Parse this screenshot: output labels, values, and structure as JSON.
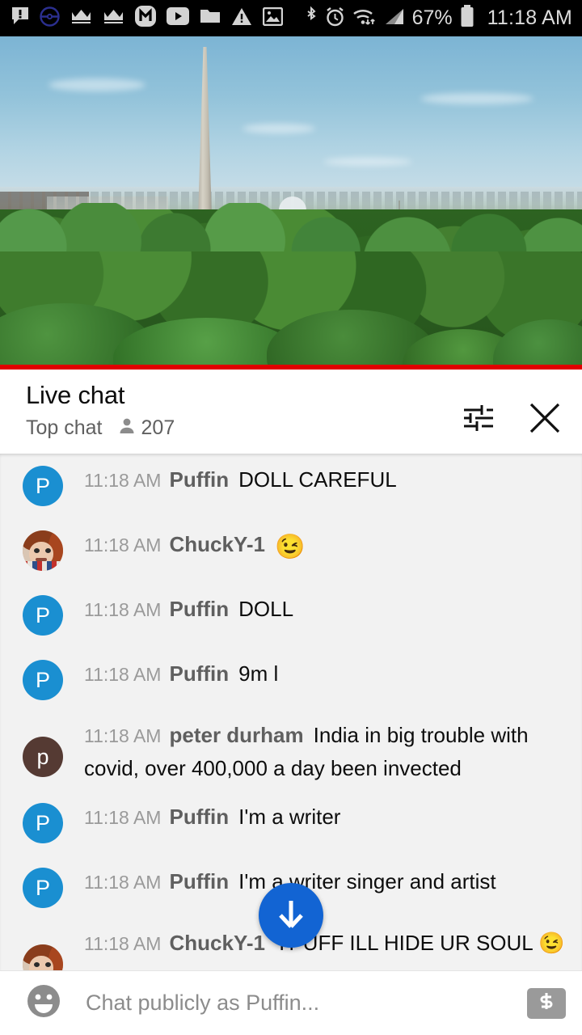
{
  "status_bar": {
    "time": "11:18 AM",
    "battery_percent": "67%",
    "left_icons": [
      "speech-bubble-alert-icon",
      "pokeball-icon",
      "crown-icon",
      "crown-icon",
      "m-app-icon",
      "youtube-icon",
      "folder-icon",
      "warning-triangle-icon",
      "image-icon"
    ],
    "right_icons": [
      "bluetooth-icon",
      "alarm-clock-icon",
      "wifi-icon",
      "cellular-signal-icon",
      "battery-icon"
    ]
  },
  "video": {
    "scene_description": "White House and Washington Monument live view",
    "progress_color": "#e00000"
  },
  "chat_header": {
    "title": "Live chat",
    "mode": "Top chat",
    "viewer_count": "207",
    "viewer_icon": "person-icon",
    "settings_icon": "tune-sliders-icon",
    "close_icon": "close-x-icon"
  },
  "messages": [
    {
      "time": "11:18 AM",
      "author": "Puffin",
      "text": "DOLL CAREFUL",
      "avatar_type": "letter",
      "avatar_letter": "P",
      "avatar_color": "#1a8fd1"
    },
    {
      "time": "11:18 AM",
      "author": "ChuckY-1",
      "text": "😉",
      "avatar_type": "photo",
      "avatar_letter": "",
      "avatar_color": "#c2866a"
    },
    {
      "time": "11:18 AM",
      "author": "Puffin",
      "text": "DOLL",
      "avatar_type": "letter",
      "avatar_letter": "P",
      "avatar_color": "#1a8fd1"
    },
    {
      "time": "11:18 AM",
      "author": "Puffin",
      "text": "9m l",
      "avatar_type": "letter",
      "avatar_letter": "P",
      "avatar_color": "#1a8fd1"
    },
    {
      "time": "11:18 AM",
      "author": "peter durham",
      "text": "India in big trouble with covid, over 400,000 a day been invected",
      "avatar_type": "letter",
      "avatar_letter": "p",
      "avatar_color": "#553a33"
    },
    {
      "time": "11:18 AM",
      "author": "Puffin",
      "text": "I'm a writer",
      "avatar_type": "letter",
      "avatar_letter": "P",
      "avatar_color": "#1a8fd1"
    },
    {
      "time": "11:18 AM",
      "author": "Puffin",
      "text": "I'm a writer singer and artist",
      "avatar_type": "letter",
      "avatar_letter": "P",
      "avatar_color": "#1a8fd1"
    },
    {
      "time": "11:18 AM",
      "author": "ChuckY-1",
      "text": "YPUFF ILL HIDE UR SOUL 😉",
      "avatar_type": "photo",
      "avatar_letter": "",
      "avatar_color": "#c2866a"
    }
  ],
  "scroll_button": {
    "icon": "arrow-down-icon",
    "color": "#1264d3"
  },
  "input_bar": {
    "emoji_icon": "emoji-smiley-icon",
    "placeholder": "Chat publicly as Puffin...",
    "value": "",
    "superchat_icon": "dollar-bill-icon"
  }
}
